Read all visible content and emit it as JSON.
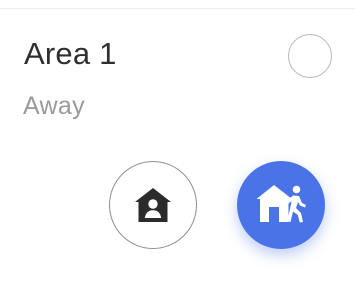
{
  "area": {
    "title": "Area 1",
    "status": "Away",
    "selected": false
  },
  "mode_buttons": [
    {
      "mode": "home",
      "icon": "home-person-icon",
      "active": false
    },
    {
      "mode": "away",
      "icon": "away-person-icon",
      "active": true
    }
  ],
  "colors": {
    "title_text": "#2f2f2f",
    "status_text": "#9a9a9a",
    "accent_blue": "#4a73e8",
    "icon_dark": "#2b2b2b",
    "outline_gray": "#8f8f8f"
  }
}
